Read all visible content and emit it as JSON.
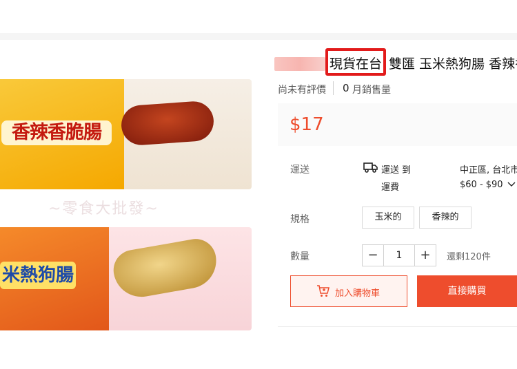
{
  "product": {
    "title_highlight": "現貨在台",
    "title_rest": "雙匯 玉米熱狗腸 香辣香",
    "rating_text": "尚未有評價",
    "sold_count": "0",
    "sold_label": "月銷售量",
    "price": "$17"
  },
  "image": {
    "label_top": "香辣香脆腸",
    "label_bottom": "米熱狗腸",
    "watermark": "~零食大批發~"
  },
  "shipping": {
    "label": "運送",
    "to_label": "運送 到",
    "fee_label": "運費",
    "location": "中正區, 台北市",
    "fee_range": "$60 - $90",
    "icon": "truck-icon"
  },
  "variants": {
    "label": "規格",
    "options": [
      "玉米的",
      "香辣的"
    ]
  },
  "quantity": {
    "label": "數量",
    "minus": "−",
    "value": "1",
    "plus": "+",
    "stock": "還剩120件"
  },
  "actions": {
    "add_to_cart": "加入購物車",
    "buy_now": "直接購買"
  },
  "colors": {
    "accent": "#ee4d2d",
    "highlight_box": "#e21b1b"
  }
}
